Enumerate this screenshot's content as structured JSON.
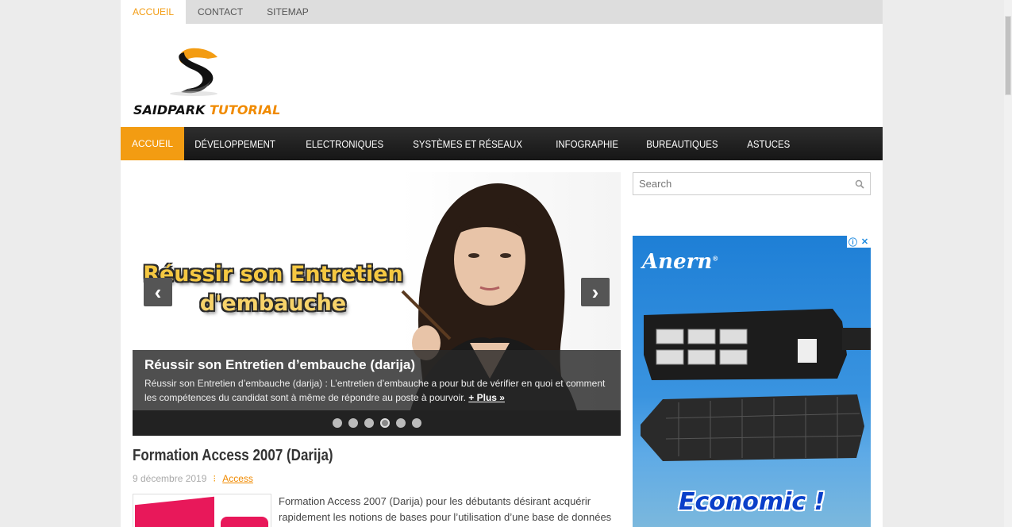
{
  "topnav": {
    "items": [
      "ACCUEIL",
      "CONTACT",
      "SITEMAP"
    ]
  },
  "logo": {
    "text_a": "SAIDPARK",
    "text_b": "TUTORIAL"
  },
  "mainnav": {
    "items": [
      "ACCUEIL",
      "DÉVELOPPEMENT",
      "ELECTRONIQUES",
      "SYSTÈMES ET RÉSEAUX",
      "INFOGRAPHIE",
      "BUREAUTIQUES",
      "ASTUCES"
    ]
  },
  "slider": {
    "image_title_line1": "Réussir son Entretien",
    "image_title_line2": "d'embauche",
    "prev": "‹",
    "next": "›",
    "caption_title": "Réussir son Entretien d’embauche (darija)",
    "caption_text": "Réussir son Entretien d’embauche (darija) : L’entretien d’embauche a pour but de vérifier en quoi et comment les compétences du candidat sont à même de répondre au poste à pourvoir. ",
    "caption_more": "+ Plus »",
    "slide_count": 6,
    "active_index": 3
  },
  "post": {
    "title": "Formation Access 2007 (Darija)",
    "date": "9 décembre 2019",
    "separator": "⁝",
    "category": "Access",
    "excerpt": "Formation Access 2007 (Darija) pour les débutants désirant acquérir rapidement les notions de bases pour l’utilisation d’une base de données"
  },
  "sidebar": {
    "search_placeholder": "Search",
    "ad": {
      "brand": "Anern",
      "brand_mark": "®",
      "slogan": "Economic !",
      "info_icon": "ⓘ",
      "close_icon": "✕"
    }
  },
  "colors": {
    "accent": "#f39c12",
    "nav_dark": "#1f1f1f",
    "ad_blue": "#1e7fd6"
  }
}
